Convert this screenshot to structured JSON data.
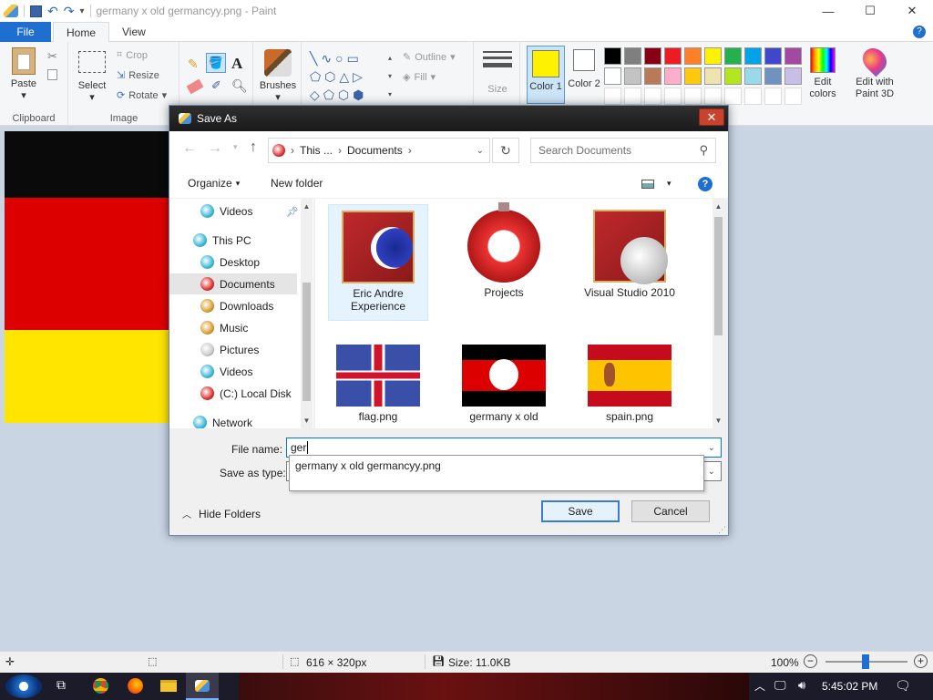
{
  "app": {
    "title": "germany x old germancyy.png - Paint"
  },
  "tabs": {
    "file": "File",
    "home": "Home",
    "view": "View"
  },
  "ribbon": {
    "clipboard": {
      "label": "Clipboard",
      "paste": "Paste"
    },
    "image": {
      "label": "Image",
      "select": "Select",
      "crop": "Crop",
      "resize": "Resize",
      "rotate": "Rotate"
    },
    "tools": {
      "brushes": "Brushes"
    },
    "shapes": {
      "outline": "Outline",
      "fill": "Fill"
    },
    "size": "Size",
    "color1": "Color 1",
    "color2": "Color 2",
    "edit_colors": "Edit colors",
    "edit_paint3d": "Edit with Paint 3D",
    "palette_row1": [
      "#000000",
      "#7f7f7f",
      "#880015",
      "#ed1c24",
      "#ff7f27",
      "#fff200",
      "#22b14c",
      "#00a2e8",
      "#3f48cc",
      "#a349a4"
    ],
    "palette_row2": [
      "#ffffff",
      "#c3c3c3",
      "#b97a57",
      "#ffaec9",
      "#ffc90e",
      "#efe4b0",
      "#b5e61d",
      "#99d9ea",
      "#7092be",
      "#c8bfe7"
    ],
    "color1_value": "#fff200",
    "color2_value": "#ffffff"
  },
  "dialog": {
    "title": "Save As",
    "breadcrumb": [
      "This ...",
      "Documents"
    ],
    "search_placeholder": "Search Documents",
    "organize": "Organize",
    "new_folder": "New folder",
    "nav_items": [
      "Videos",
      "This PC",
      "Desktop",
      "Documents",
      "Downloads",
      "Music",
      "Pictures",
      "Videos",
      "(C:) Local Disk",
      "Network"
    ],
    "files": [
      {
        "name": "Eric Andre Experience"
      },
      {
        "name": "Projects"
      },
      {
        "name": "Visual Studio 2010"
      },
      {
        "name": "flag.png"
      },
      {
        "name": "germany x old"
      },
      {
        "name": "spain.png"
      }
    ],
    "file_name_label": "File name:",
    "file_name_value": "ger",
    "save_as_type_label": "Save as type:",
    "suggestion": "germany x old germancyy.png",
    "hide_folders": "Hide Folders",
    "save": "Save",
    "cancel": "Cancel"
  },
  "status": {
    "dimensions": "616 × 320px",
    "size": "Size: 11.0KB",
    "zoom": "100%"
  },
  "taskbar": {
    "time": "5:45:02 PM"
  }
}
